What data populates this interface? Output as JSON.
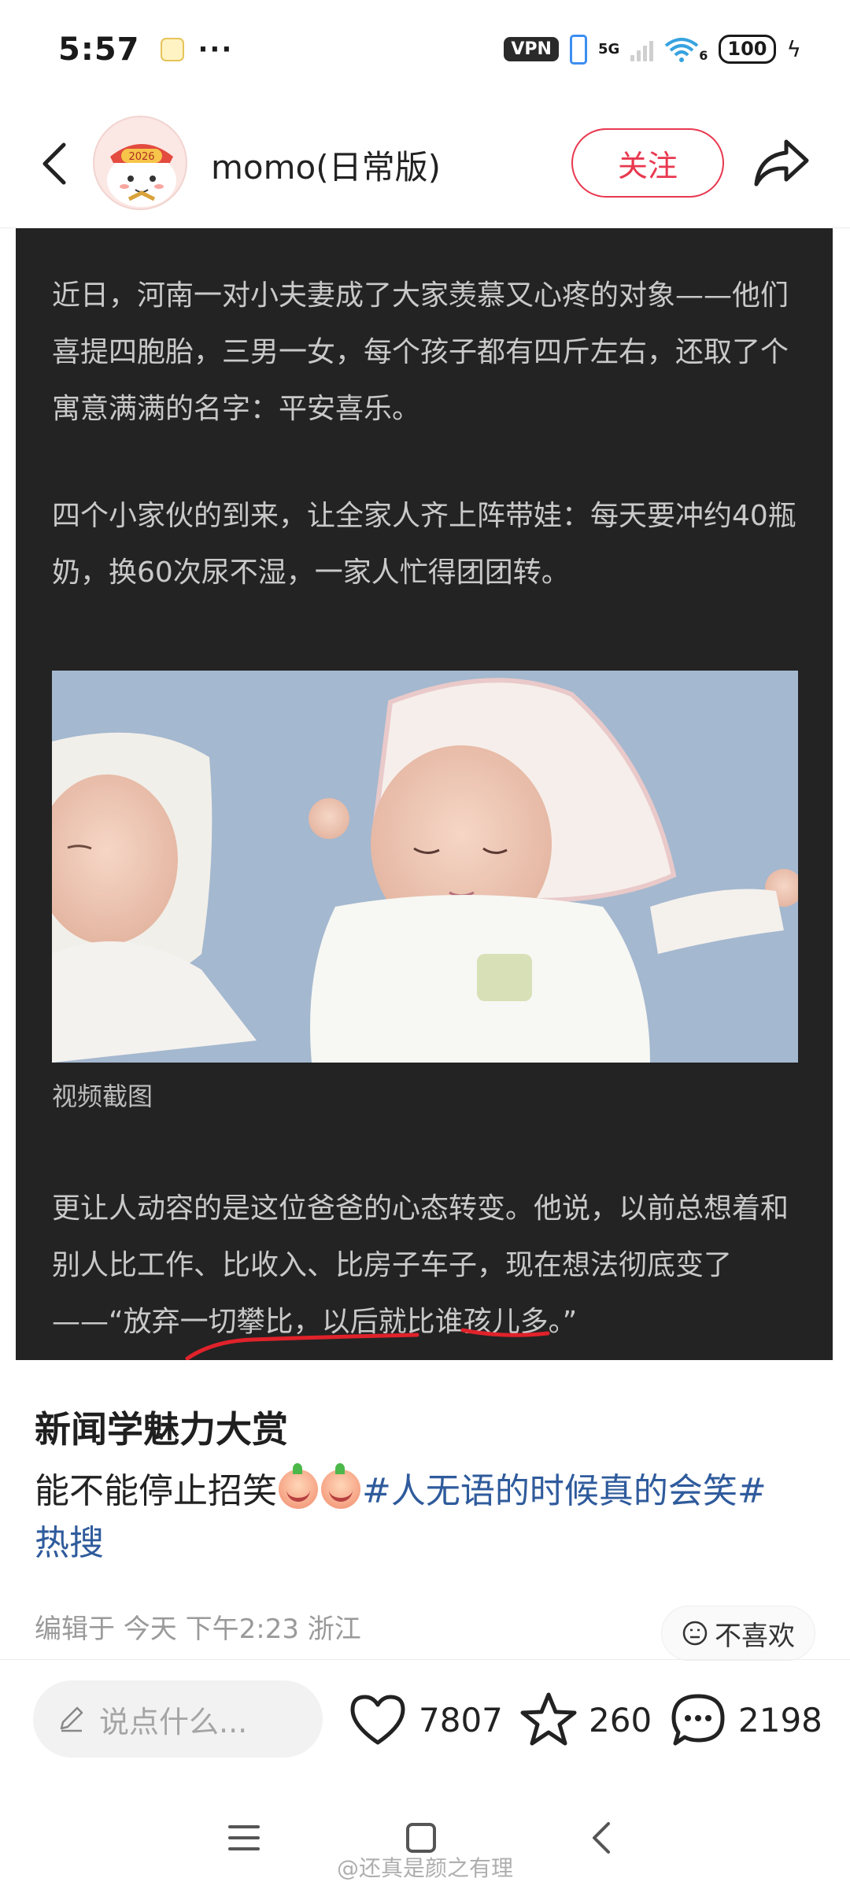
{
  "status_bar": {
    "time": "5:57",
    "dots": "···",
    "vpn": "VPN",
    "network": "5G",
    "wifi_label": "6",
    "battery": "100"
  },
  "header": {
    "author_name": "momo(日常版)",
    "avatar_label": "2026",
    "follow_label": "关注"
  },
  "article_image": {
    "paragraph_1": "近日，河南一对小夫妻成了大家羡慕又心疼的对象——他们喜提四胞胎，三男一女，每个孩子都有四斤左右，还取了个寓意满满的名字：平安喜乐。",
    "paragraph_2": "四个小家伙的到来，让全家人齐上阵带娃：每天要冲约40瓶奶，换60次尿不湿，一家人忙得团团转。",
    "photo_caption": "视频截图",
    "paragraph_3": "更让人动容的是这位爸爸的心态转变。他说，以前总想着和别人比工作、比收入、比房子车子，现在想法彻底变了——“放弃一切攀比，以后就比谁孩儿多。”",
    "underline_color": "#e0222b"
  },
  "post": {
    "title": "新闻学魅力大赏",
    "text_before_emoji": "能不能停止招笑",
    "hashtag_1": "#人无语的时候真的会笑#",
    "hashtag_2": "热搜",
    "meta": "编辑于  今天 下午2:23 浙江",
    "dislike_label": "不喜欢"
  },
  "actions": {
    "comment_placeholder": "说点什么...",
    "likes": "7807",
    "favorites": "260",
    "comments": "2198"
  },
  "footer": {
    "watermark": "@还真是颜之有理"
  },
  "colors": {
    "accent": "#e8384f",
    "hashtag": "#2f5b9c",
    "article_bg": "#232323"
  }
}
